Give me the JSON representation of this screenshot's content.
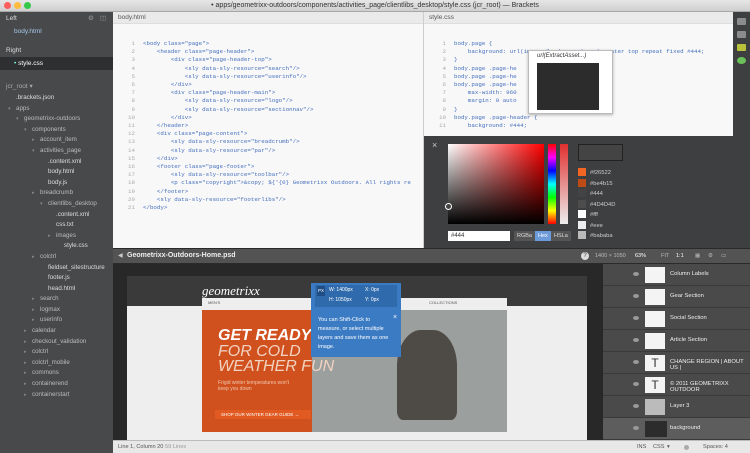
{
  "window": {
    "title": "• apps/geometrixx-outdoors/components/activities_page/clientlibs_desktop/style.css (jcr_root) — Brackets"
  },
  "working_files": {
    "left_label": "Left",
    "left_files": [
      "body.html"
    ],
    "right_label": "Right",
    "right_files": [
      "style.css"
    ]
  },
  "tree": {
    "root": "jcr_root ▾",
    "items": [
      {
        "label": ".brackets.json",
        "indent": 0,
        "arrow": "",
        "file": true
      },
      {
        "label": "apps",
        "indent": 0,
        "arrow": "▾",
        "file": false
      },
      {
        "label": "geometrixx-outdoors",
        "indent": 1,
        "arrow": "▾",
        "file": false
      },
      {
        "label": "components",
        "indent": 2,
        "arrow": "▾",
        "file": false
      },
      {
        "label": "account_item",
        "indent": 3,
        "arrow": "▸",
        "file": false
      },
      {
        "label": "activities_page",
        "indent": 3,
        "arrow": "▾",
        "file": false
      },
      {
        "label": ".content.xml",
        "indent": 4,
        "arrow": "",
        "file": true
      },
      {
        "label": "body.html",
        "indent": 4,
        "arrow": "",
        "file": true
      },
      {
        "label": "body.js",
        "indent": 4,
        "arrow": "",
        "file": true
      },
      {
        "label": "breadcrumb",
        "indent": 3,
        "arrow": "▸",
        "file": false
      },
      {
        "label": "clientlibs_desktop",
        "indent": 4,
        "arrow": "▾",
        "file": false
      },
      {
        "label": ".content.xml",
        "indent": 5,
        "arrow": "",
        "file": true
      },
      {
        "label": "css.txt",
        "indent": 5,
        "arrow": "",
        "file": true
      },
      {
        "label": "images",
        "indent": 5,
        "arrow": "▸",
        "file": false
      },
      {
        "label": "style.css",
        "indent": 6,
        "arrow": "",
        "file": true
      },
      {
        "label": "colctrl",
        "indent": 3,
        "arrow": "▸",
        "file": false
      },
      {
        "label": "fieldset_sitestructure",
        "indent": 4,
        "arrow": "",
        "file": true
      },
      {
        "label": "footer.js",
        "indent": 4,
        "arrow": "",
        "file": true
      },
      {
        "label": "head.html",
        "indent": 4,
        "arrow": "",
        "file": true
      },
      {
        "label": "search",
        "indent": 3,
        "arrow": "▸",
        "file": false
      },
      {
        "label": "logmax",
        "indent": 3,
        "arrow": "▸",
        "file": false
      },
      {
        "label": "userinfo",
        "indent": 3,
        "arrow": "▸",
        "file": false
      },
      {
        "label": "calendar",
        "indent": 2,
        "arrow": "▸",
        "file": false
      },
      {
        "label": "checkout_validation",
        "indent": 2,
        "arrow": "▸",
        "file": false
      },
      {
        "label": "colctrl",
        "indent": 2,
        "arrow": "▸",
        "file": false
      },
      {
        "label": "colctrl_mobile",
        "indent": 2,
        "arrow": "▸",
        "file": false
      },
      {
        "label": "commons",
        "indent": 2,
        "arrow": "▸",
        "file": false
      },
      {
        "label": "containerend",
        "indent": 2,
        "arrow": "▸",
        "file": false
      },
      {
        "label": "containerstart",
        "indent": 2,
        "arrow": "▸",
        "file": false
      }
    ]
  },
  "left_pane": {
    "tab": "body.html",
    "lines": [
      [
        "1",
        "<body class=\"page\">"
      ],
      [
        "2",
        "    <header class=\"page-header\">"
      ],
      [
        "3",
        "        <div class=\"page-header-top\">"
      ],
      [
        "4",
        "            <sly data-sly-resource=\"search\"/>"
      ],
      [
        "5",
        "            <sly data-sly-resource=\"userinfo\"/>"
      ],
      [
        "6",
        "        </div>"
      ],
      [
        "7",
        "        <div class=\"page-header-main\">"
      ],
      [
        "8",
        "            <sly data-sly-resource=\"logo\"/>"
      ],
      [
        "9",
        "            <sly data-sly-resource=\"sectionnav\"/>"
      ],
      [
        "10",
        "        </div>"
      ],
      [
        "11",
        "    </header>"
      ],
      [
        "12",
        "    <div class=\"page-content\">"
      ],
      [
        "13",
        "        <sly data-sly-resource=\"breadcrumb\"/>"
      ],
      [
        "14",
        "        <sly data-sly-resource=\"par\"/>"
      ],
      [
        "15",
        "    </div>"
      ],
      [
        "16",
        "    <footer class=\"page-footer\">"
      ],
      [
        "17",
        "        <sly data-sly-resource=\"toolbar\"/>"
      ],
      [
        "18",
        "        <p class=\"copyright\">&copy; ${'{0} Geometrixx Outdoors. All rights re"
      ],
      [
        "19",
        "    </footer>"
      ],
      [
        "20",
        "    <sly data-sly-resource=\"footerlibs\"/>"
      ],
      [
        "21",
        "</body>"
      ]
    ]
  },
  "right_pane": {
    "tab": "style.css",
    "lines": [
      [
        "1",
        "body.page {"
      ],
      [
        "2",
        "    background: url(images/background.png) center top repeat fixed #444;"
      ],
      [
        "3",
        "}"
      ],
      [
        "4",
        "body.page .page-he"
      ],
      [
        "5",
        "body.page .page-he"
      ],
      [
        "6",
        "body.page .page-he"
      ],
      [
        "7",
        "    max-width: 960"
      ],
      [
        "8",
        "    margin: 0 auto"
      ],
      [
        "9",
        "}"
      ],
      [
        "10",
        "body.page .page-header {"
      ],
      [
        "11",
        "    background: #444;"
      ]
    ],
    "hint_header": "url(ExtractAsset...)"
  },
  "color_picker": {
    "hex": "#444",
    "formats": [
      "RGBa",
      "Hex",
      "HSLa"
    ],
    "swatches": [
      {
        "color": "#f26522",
        "label": "#f26522"
      },
      {
        "color": "#be4b15",
        "label": "#be4b15"
      },
      {
        "color": "#444444",
        "label": "#444"
      },
      {
        "color": "#4d4d4d",
        "label": "#4D4D4D"
      },
      {
        "color": "#ffffff",
        "label": "#fff"
      },
      {
        "color": "#eeeeee",
        "label": "#eee"
      },
      {
        "color": "#bababa",
        "label": "#bababa"
      }
    ]
  },
  "psd_bar": {
    "title": "Geometrixx-Outdoors-Home.psd",
    "size": "1400 × 1050",
    "zoom": "63%",
    "fit": "FIT",
    "ratio": "1:1"
  },
  "canvas": {
    "logo": "geometrixx",
    "nav": [
      "MEN'S",
      "EQUIPMENT",
      "SEASONAL",
      "COLLECTIONS"
    ],
    "hero_lines": [
      "GET READY",
      "FOR COLD",
      "WEATHER FUN"
    ],
    "hero_sub": "Frigid winter temperatures won't keep you down",
    "cta": "SHOP OUR WINTER GEAR GUIDE →"
  },
  "tooltip": {
    "w": "W: 1400px",
    "h": "H: 1050px",
    "x": "X: 0px",
    "y": "Y: 0px",
    "body": [
      "You can Shift-Click to",
      "measure, or select multiple",
      "layers and save them as one",
      "image."
    ]
  },
  "layers": [
    {
      "name": "Column Labels"
    },
    {
      "name": "Gear Section"
    },
    {
      "name": "Social Section"
    },
    {
      "name": "Article Section"
    },
    {
      "name": "CHANGE REGION | ABOUT US |"
    },
    {
      "name": "© 2011 GEOMETRIXX OUTDOOR"
    },
    {
      "name": "Layer 3"
    },
    {
      "name": "background"
    }
  ],
  "status": {
    "cursor": "Line 1, Column 20",
    "lines": "59 Lines",
    "ins": "INS",
    "lang": "CSS",
    "spaces": "Spaces: 4"
  }
}
